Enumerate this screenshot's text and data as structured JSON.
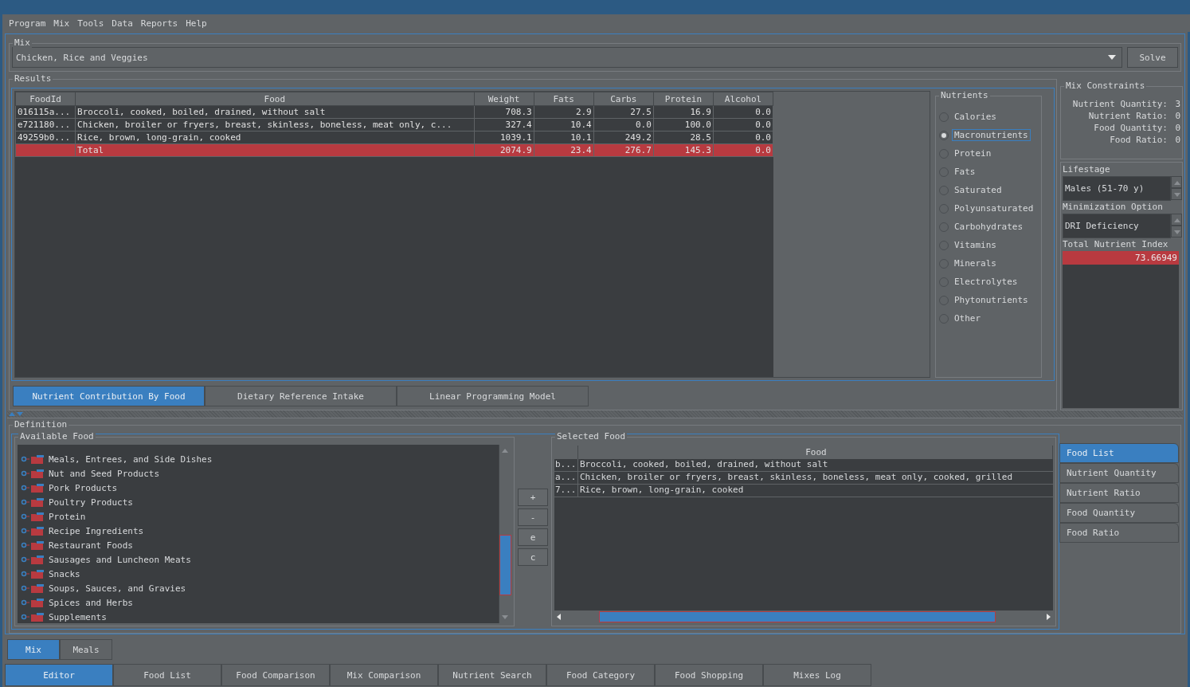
{
  "menu": [
    "Program",
    "Mix",
    "Tools",
    "Data",
    "Reports",
    "Help"
  ],
  "mix": {
    "title": "Mix",
    "value": "Chicken, Rice and Veggies",
    "solve_button": "Solve"
  },
  "results": {
    "title": "Results",
    "table": {
      "columns": [
        "FoodId",
        "Food",
        "Weight",
        "Fats",
        "Carbs",
        "Protein",
        "Alcohol"
      ],
      "rows": [
        {
          "kind": "food",
          "food_id": "016115a...",
          "food": "Broccoli, cooked, boiled, drained, without salt",
          "values": [
            "708.3",
            "2.9",
            "27.5",
            "16.9",
            "0.0"
          ]
        },
        {
          "kind": "food",
          "food_id": "e721180...",
          "food": "Chicken, broiler or fryers, breast, skinless, boneless, meat only, c...",
          "values": [
            "327.4",
            "10.4",
            "0.0",
            "100.0",
            "0.0"
          ]
        },
        {
          "kind": "food",
          "food_id": "49259b0...",
          "food": "Rice, brown, long-grain, cooked",
          "values": [
            "1039.1",
            "10.1",
            "249.2",
            "28.5",
            "0.0"
          ]
        },
        {
          "kind": "total",
          "food": "Total",
          "values": [
            "2074.9",
            "23.4",
            "276.7",
            "145.3",
            "0.0"
          ]
        }
      ]
    },
    "nutrients": {
      "title": "Nutrients",
      "options": [
        {
          "label": "Calories",
          "selected": false
        },
        {
          "label": "Macronutrients",
          "selected": true
        },
        {
          "label": "Protein",
          "selected": false
        },
        {
          "label": "Fats",
          "selected": false
        },
        {
          "label": "Saturated",
          "selected": false
        },
        {
          "label": "Polyunsaturated",
          "selected": false
        },
        {
          "label": "Carbohydrates",
          "selected": false
        },
        {
          "label": "Vitamins",
          "selected": false
        },
        {
          "label": "Minerals",
          "selected": false
        },
        {
          "label": "Electrolytes",
          "selected": false
        },
        {
          "label": "Phytonutrients",
          "selected": false
        },
        {
          "label": "Other",
          "selected": false
        }
      ]
    },
    "tabs": [
      {
        "label": "Nutrient Contribution By Food",
        "selected": true
      },
      {
        "label": "Dietary Reference Intake",
        "selected": false
      },
      {
        "label": "Linear Programming Model",
        "selected": false
      }
    ]
  },
  "constraints": {
    "title": "Mix Constraints",
    "items": [
      {
        "label": "Nutrient Quantity:",
        "value": "3"
      },
      {
        "label": "Nutrient Ratio:",
        "value": "0"
      },
      {
        "label": "Food Quantity:",
        "value": "0"
      },
      {
        "label": "Food Ratio:",
        "value": "0"
      }
    ]
  },
  "lifestage": {
    "label": "Lifestage",
    "value": "Males (51-70 y)"
  },
  "minimization": {
    "label": "Minimization Option",
    "value": "DRI Deficiency"
  },
  "total_nutrient_index": {
    "label": "Total Nutrient Index",
    "value": "73.66949"
  },
  "definition": {
    "title": "Definition",
    "available_food": {
      "title": "Available Food",
      "categories": [
        "Meals, Entrees, and Side Dishes",
        "Nut and Seed Products",
        "Pork Products",
        "Poultry Products",
        "Protein",
        "Recipe Ingredients",
        "Restaurant Foods",
        "Sausages and Luncheon Meats",
        "Snacks",
        "Soups, Sauces, and Gravies",
        "Spices and Herbs",
        "Supplements"
      ]
    },
    "buttons": [
      "+",
      "-",
      "e",
      "c"
    ],
    "selected_food": {
      "title": "Selected Food",
      "column": "Food",
      "rows": [
        {
          "id": "b...",
          "food": "Broccoli, cooked, boiled, drained, without salt"
        },
        {
          "id": "a...",
          "food": "Chicken, broiler or fryers, breast, skinless, boneless, meat only, cooked, grilled"
        },
        {
          "id": "7...",
          "food": "Rice, brown, long-grain, cooked"
        }
      ]
    },
    "side_tabs": [
      {
        "label": "Food List",
        "selected": true
      },
      {
        "label": "Nutrient Quantity",
        "selected": false
      },
      {
        "label": "Nutrient Ratio",
        "selected": false
      },
      {
        "label": "Food Quantity",
        "selected": false
      },
      {
        "label": "Food Ratio",
        "selected": false
      }
    ]
  },
  "view_tabs": [
    {
      "label": "Mix",
      "selected": true
    },
    {
      "label": "Meals",
      "selected": false
    }
  ],
  "bottom_tabs": [
    {
      "label": "Editor",
      "selected": true
    },
    {
      "label": "Food List",
      "selected": false
    },
    {
      "label": "Food Comparison",
      "selected": false
    },
    {
      "label": "Mix Comparison",
      "selected": false
    },
    {
      "label": "Nutrient Search",
      "selected": false
    },
    {
      "label": "Food Category",
      "selected": false
    },
    {
      "label": "Food Shopping",
      "selected": false
    },
    {
      "label": "Mixes Log",
      "selected": false
    }
  ]
}
